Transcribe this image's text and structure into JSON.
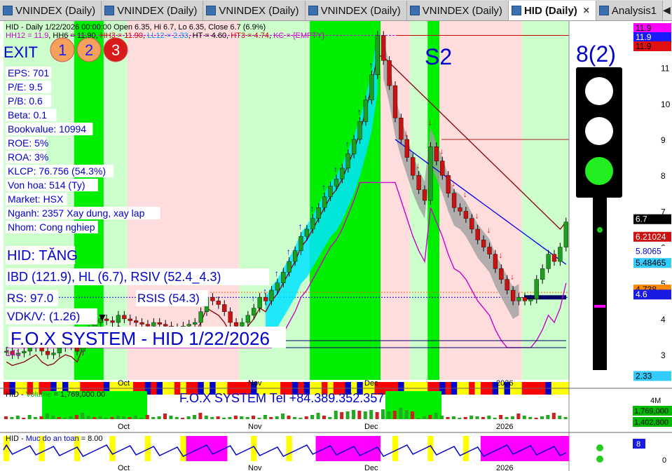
{
  "tabs": [
    {
      "label": "VNINDEX (Daily)",
      "active": false
    },
    {
      "label": "VNINDEX (Daily)",
      "active": false
    },
    {
      "label": "VNINDEX (Daily)",
      "active": false
    },
    {
      "label": "VNINDEX (Daily)",
      "active": false
    },
    {
      "label": "VNINDEX (Daily)",
      "active": false
    },
    {
      "label": "HID (Daily)",
      "active": true
    },
    {
      "label": "Analysis1",
      "active": false
    }
  ],
  "tab_close": "✕",
  "nav_left": "◀",
  "nav_right": "▶",
  "header": {
    "line1": "HID - Daily 1/22/2026 00:00:00 Open 6.35, Hi 6.7, Lo 6.35, Close 6.7 (6.9%)",
    "line2_parts": [
      {
        "text": "HH12 = 11.9",
        "color": "#cc00cc"
      },
      {
        "text": ", HH6 = 11.90, ",
        "color": "#000000"
      },
      {
        "text": "HH3 = 11.90",
        "color": "#cc0000"
      },
      {
        "text": ", ",
        "color": "#000000"
      },
      {
        "text": "LL12 = 2.33",
        "color": "#0099ff"
      },
      {
        "text": ", HT  = 4.60, ",
        "color": "#000000"
      },
      {
        "text": "HT3  = 4.74",
        "color": "#cc0000"
      },
      {
        "text": ", ",
        "color": "#000000"
      },
      {
        "text": "KC = {EMPTY}",
        "color": "#cc00cc"
      }
    ]
  },
  "exit": {
    "label": "EXIT",
    "badges": [
      "1",
      "2",
      "3"
    ],
    "badge_colors": [
      "#f4a15a",
      "#f4a15a",
      "#d91a1a"
    ]
  },
  "fundamentals": [
    "EPS: 701",
    "P/E: 9.5",
    "P/B: 0.6",
    "Beta: 0.1",
    "Bookvalue: 10994",
    "ROE: 5%",
    "ROA: 3%",
    "KLCP: 76.756 (54.3%)",
    "Von hoa: 514 (Ty)",
    "Market: HSX",
    "Nganh: 2357 Xay dung, xay lap",
    "Nhom: Cong nghiep"
  ],
  "status": {
    "trend": "HID: TĂNG",
    "ibd": "IBD (121.9), HL (6.7), RSIV (52.4_4.3)",
    "rs": "RS: 97.0",
    "rsis": "RSIS (54.3)",
    "vdk": "VDK/V:  (1.26)"
  },
  "fox_title": "F.O.X SYSTEM - HID 1/22/2026",
  "fox_contact": "F.O.X SYSTEM Tel +84.389.352.357",
  "label_141": "141",
  "s2_label": "S2",
  "signal": {
    "label": "8(2)",
    "lights": [
      "off",
      "off",
      "green"
    ]
  },
  "price_axis": {
    "ticks": [
      3,
      4,
      5,
      6,
      7,
      8,
      9,
      10,
      11
    ],
    "range": [
      2.3,
      12.3
    ]
  },
  "price_tags": [
    {
      "text": "11.9",
      "value": 11.9,
      "bg": "#ff00ff",
      "fg": "#000000"
    },
    {
      "text": "11.9",
      "value": 11.9,
      "bg": "#1a1aff",
      "fg": "#ffffff"
    },
    {
      "text": "11.9",
      "value": 11.9,
      "bg": "#e01010",
      "fg": "#000000"
    },
    {
      "text": "6.7",
      "value": 6.7,
      "bg": "#000000",
      "fg": "#ffffff"
    },
    {
      "text": "6.21024",
      "value": 6.21,
      "bg": "#cc1111",
      "fg": "#ffffff"
    },
    {
      "text": "5.8065",
      "value": 5.81,
      "bg": "#ffffff",
      "fg": "#0000cc"
    },
    {
      "text": "5.48465",
      "value": 5.48,
      "bg": "#33ccff",
      "fg": "#000000"
    },
    {
      "text": "4.738",
      "value": 4.74,
      "bg": "#ff8800",
      "fg": "#000000"
    },
    {
      "text": "4.6",
      "value": 4.6,
      "bg": "#1a1ae0",
      "fg": "#ffffff"
    },
    {
      "text": "2.33",
      "value": 2.33,
      "bg": "#33ccff",
      "fg": "#000000"
    }
  ],
  "months": [
    "Oct",
    "Nov",
    "Dec",
    "2026"
  ],
  "volume": {
    "label_prefix": "HID - ",
    "label_name": "Volume",
    "label_value": " = 1,769,000.00",
    "axis_top": "4M",
    "tags": [
      {
        "text": "1,769,000",
        "bg": "#00bb00",
        "fg": "#000000"
      },
      {
        "text": "1,402,800",
        "bg": "#00bb00",
        "fg": "#000000"
      }
    ]
  },
  "safety": {
    "label_prefix": "HID - ",
    "label_name": "Muc do an toan",
    "label_value": " = 8.00",
    "tag": "8",
    "axis_zero": "0"
  },
  "chart_data": {
    "type": "candlestick",
    "title": "HID - Daily 1/22/2026",
    "x_range": [
      "2025-09-08",
      "2026-01-22"
    ],
    "y_range": [
      2.3,
      12.3
    ],
    "ohlc_last": {
      "date": "2026-01-22",
      "open": 6.35,
      "high": 6.7,
      "low": 6.35,
      "close": 6.7,
      "change_pct": 6.9
    },
    "close": [
      3.1,
      3.0,
      3.05,
      3.1,
      3.2,
      3.3,
      3.1,
      3.0,
      3.05,
      3.2,
      3.3,
      3.25,
      3.1,
      3.5,
      3.7,
      3.9,
      4.0,
      3.95,
      3.9,
      4.1,
      4.0,
      3.95,
      3.9,
      3.85,
      3.8,
      3.9,
      3.85,
      3.8,
      3.75,
      3.7,
      3.8,
      3.85,
      3.9,
      4.2,
      4.6,
      4.5,
      4.4,
      4.2,
      3.9,
      3.8,
      3.9,
      4.1,
      4.3,
      4.6,
      4.5,
      4.8,
      5.0,
      5.3,
      5.6,
      5.9,
      6.3,
      6.5,
      6.8,
      7.1,
      7.4,
      7.7,
      7.9,
      8.2,
      8.6,
      9.0,
      9.5,
      10.1,
      10.8,
      11.9,
      11.2,
      10.5,
      9.6,
      9.0,
      8.5,
      8.0,
      7.6,
      7.3,
      8.8,
      8.4,
      8.0,
      7.5,
      7.1,
      7.0,
      6.8,
      6.5,
      6.2,
      6.0,
      5.8,
      5.4,
      5.1,
      4.8,
      4.5,
      4.6,
      4.5,
      4.55,
      5.1,
      5.4,
      5.8,
      5.6,
      6.0,
      6.7
    ],
    "series": [
      {
        "name": "HH12",
        "value": 11.9
      },
      {
        "name": "LL12",
        "value": 2.33
      },
      {
        "name": "HT",
        "value": 4.6
      },
      {
        "name": "HT3",
        "value": 4.74
      }
    ],
    "volume_last": 1769000,
    "volume_avg": 1402800,
    "safety_level": 8
  }
}
